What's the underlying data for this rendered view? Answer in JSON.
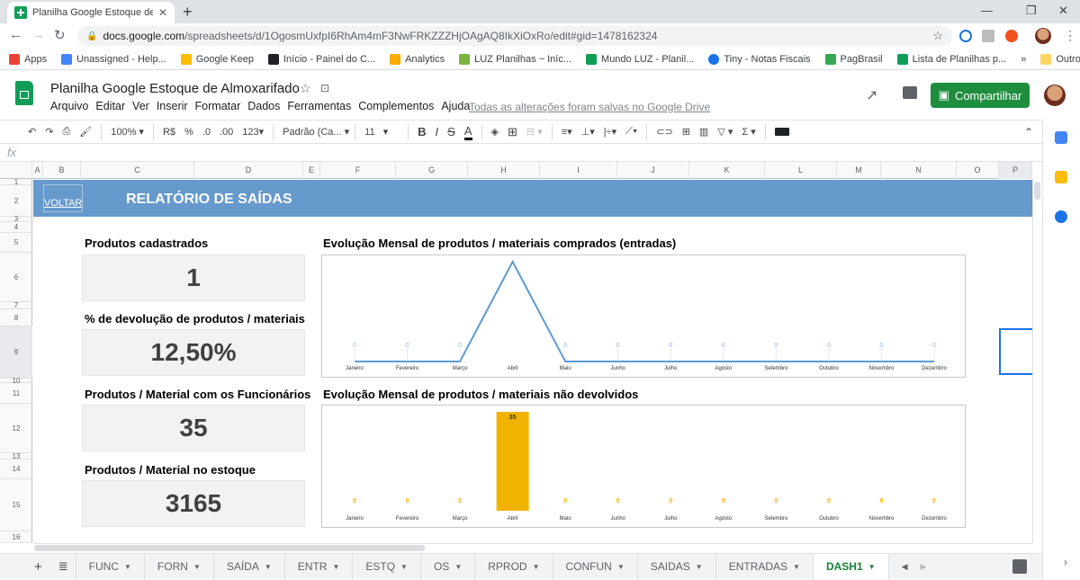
{
  "browser": {
    "tab_title": "Planilha Google Estoque de Almc",
    "url_host": "docs.google.com",
    "url_path": "/spreadsheets/d/1OgosmUxfpI6RhAm4mF3NwFRKZZZHjOAgAQ8IkXiOxRo/edit#gid=1478162324",
    "bookmarks": [
      {
        "label": "Apps",
        "color": "#ea4335"
      },
      {
        "label": "Unassigned - Help...",
        "color": "#4285f4"
      },
      {
        "label": "Google Keep",
        "color": "#fbbc04"
      },
      {
        "label": "Início - Painel do C...",
        "color": "#202124"
      },
      {
        "label": "Analytics",
        "color": "#f9ab00"
      },
      {
        "label": "LUZ Planilhas ~ Iníc...",
        "color": "#7cb342"
      },
      {
        "label": "Mundo LUZ - Planil...",
        "color": "#0f9d58"
      },
      {
        "label": "Tiny - Notas Fiscais",
        "color": "#1a73e8"
      },
      {
        "label": "PagBrasil",
        "color": "#34a853"
      },
      {
        "label": "Lista de Planilhas p...",
        "color": "#0f9d58"
      }
    ],
    "bookmarks_more": "»",
    "other_bookmarks": "Outros favoritos"
  },
  "sheets": {
    "doc_title": "Planilha Google Estoque de Almoxarifado",
    "menu": [
      "Arquivo",
      "Editar",
      "Ver",
      "Inserir",
      "Formatar",
      "Dados",
      "Ferramentas",
      "Complementos",
      "Ajuda"
    ],
    "saved_status": "Todas as alterações foram salvas no Google Drive",
    "share_label": "Compartilhar",
    "toolbar": {
      "zoom": "100%",
      "currency": "R$",
      "percent": "%",
      "dec_less": ".0",
      "dec_more": ".00",
      "number_format": "123",
      "font": "Padrão (Ca...",
      "font_size": "11"
    },
    "fx": "fx",
    "columns": [
      "A",
      "B",
      "C",
      "D",
      "E",
      "F",
      "G",
      "H",
      "I",
      "J",
      "K",
      "L",
      "M",
      "N",
      "O",
      "P"
    ],
    "rows": [
      "1",
      "2",
      "3",
      "4",
      "5",
      "6",
      "7",
      "8",
      "9",
      "10",
      "11",
      "12",
      "13",
      "14",
      "15",
      "16"
    ],
    "sheet_tabs": [
      "FUNC",
      "FORN",
      "SAÍDA",
      "ENTR",
      "ESTQ",
      "OS",
      "RPROD",
      "CONFUN",
      "SAIDAS",
      "ENTRADAS",
      "DASH1"
    ],
    "active_tab": "DASH1"
  },
  "dashboard": {
    "voltar": "VOLTAR",
    "title": "RELATÓRIO DE SAÍDAS",
    "banner_color": "#6699cc",
    "kpis": [
      {
        "label": "Produtos cadastrados",
        "value": "1"
      },
      {
        "label": "% de devolução de produtos / materiais",
        "value": "12,50%"
      },
      {
        "label": "Produtos / Material com os Funcionários",
        "value": "35"
      },
      {
        "label": "Produtos / Material no estoque",
        "value": "3165"
      }
    ]
  },
  "chart_data": [
    {
      "type": "line",
      "title": "Evolução Mensal de produtos / materiais comprados (entradas)",
      "categories": [
        "Janeiro",
        "Fevereiro",
        "Março",
        "Abril",
        "Maio",
        "Junho",
        "Julho",
        "Agosto",
        "Setembro",
        "Outubro",
        "Novembro",
        "Dezembro"
      ],
      "values": [
        0,
        0,
        0,
        35,
        0,
        0,
        0,
        0,
        0,
        0,
        0,
        0
      ],
      "labels_shown": [
        true,
        true,
        true,
        false,
        true,
        true,
        true,
        true,
        true,
        true,
        true,
        true
      ],
      "color": "#5b9bd5",
      "xlabel": "",
      "ylabel": "",
      "grid": false
    },
    {
      "type": "bar",
      "title": "Evolução Mensal de produtos / materiais não devolvidos",
      "categories": [
        "Janeiro",
        "Fevereiro",
        "Março",
        "Abril",
        "Maio",
        "Junho",
        "Julho",
        "Agosto",
        "Setembro",
        "Outubro",
        "Novembro",
        "Dezembro"
      ],
      "values": [
        0,
        0,
        0,
        35,
        0,
        0,
        0,
        0,
        0,
        0,
        0,
        0
      ],
      "color": "#f0b400",
      "xlabel": "",
      "ylabel": "",
      "grid": false
    }
  ]
}
